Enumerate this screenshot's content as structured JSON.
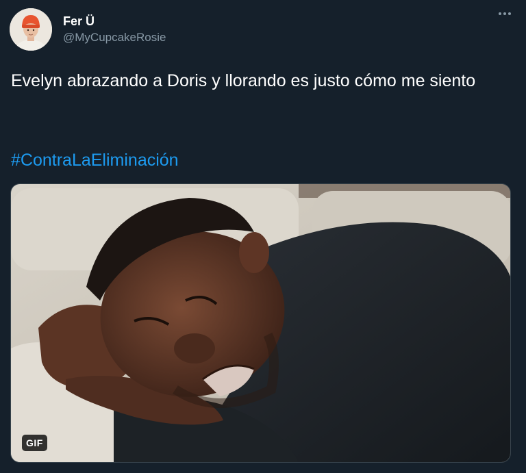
{
  "tweet": {
    "display_name": "Fer Ü",
    "handle": "@MyCupcakeRosie",
    "text": "Evelyn abrazando a Doris y llorando es justo cómo me siento",
    "hashtag": "#ContraLaEliminación",
    "media_badge": "GIF",
    "more_icon": "more-horizontal-icon"
  },
  "colors": {
    "background": "#15202b",
    "primary_text": "#ffffff",
    "secondary_text": "#8899a6",
    "link": "#1d9bf0"
  }
}
